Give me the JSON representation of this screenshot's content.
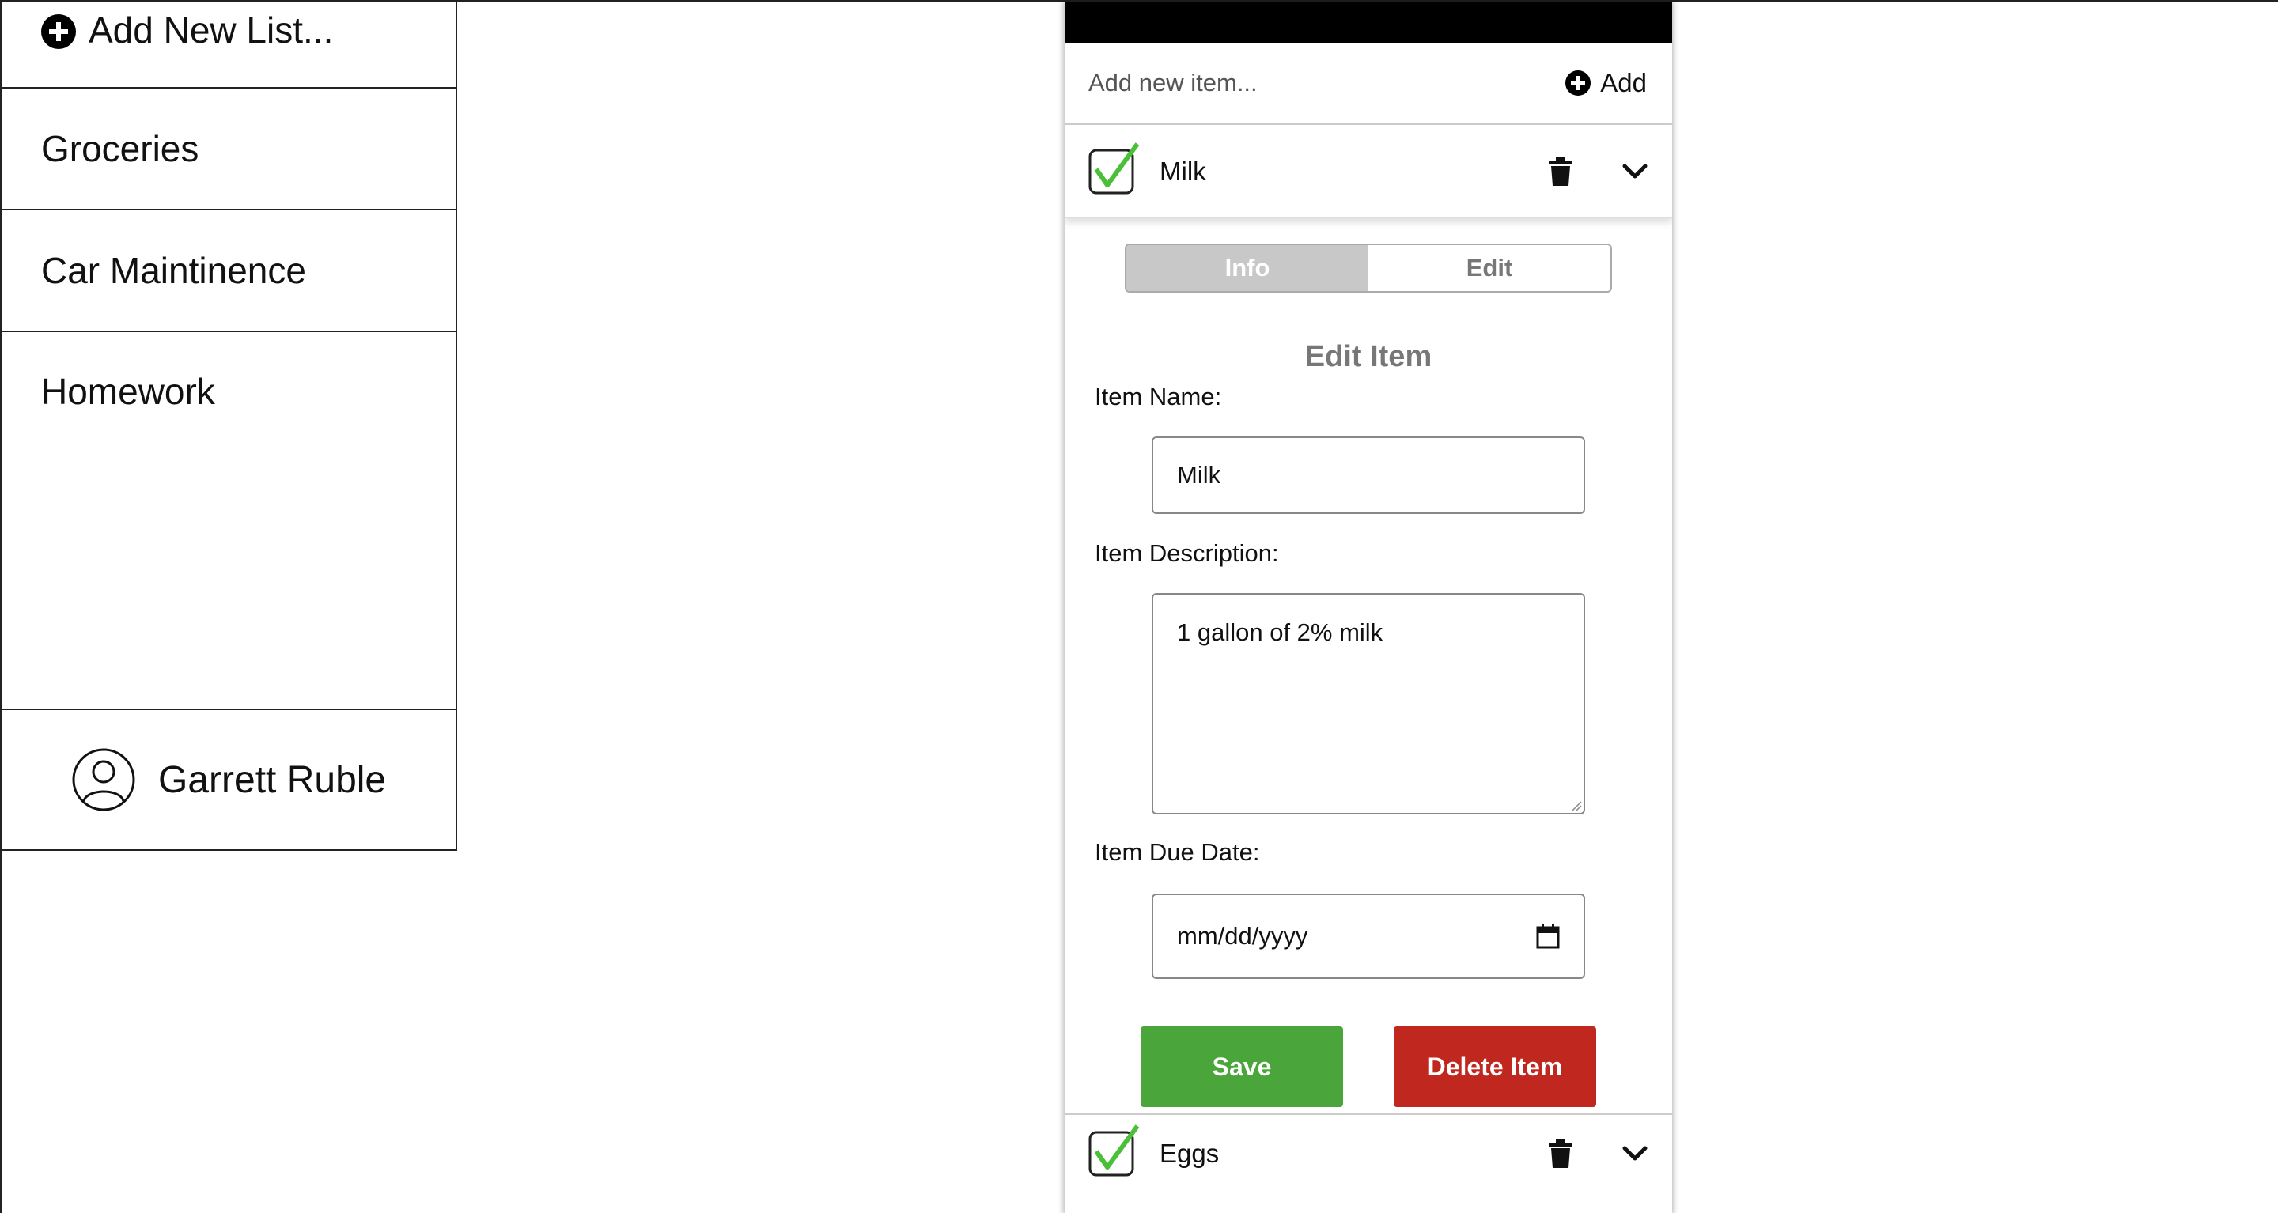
{
  "sidebar": {
    "add_list_label": "Add New List...",
    "lists": [
      {
        "label": "Groceries"
      },
      {
        "label": "Car Maintinence"
      },
      {
        "label": "Homework"
      }
    ],
    "user_name": "Garrett Ruble"
  },
  "panel": {
    "add_item_placeholder": "Add new item...",
    "add_button_label": "Add",
    "items": [
      {
        "name": "Milk",
        "checked": true,
        "expanded": true
      },
      {
        "name": "Eggs",
        "checked": true,
        "expanded": false
      }
    ],
    "tabs": [
      {
        "label": "Info",
        "active": true
      },
      {
        "label": "Edit",
        "active": false
      }
    ],
    "form": {
      "title": "Edit Item",
      "name_label": "Item Name:",
      "name_value": "Milk",
      "description_label": "Item Description:",
      "description_value": "1 gallon of 2% milk",
      "due_date_label": "Item Due Date:",
      "due_date_placeholder": "mm/dd/yyyy",
      "save_label": "Save",
      "delete_label": "Delete Item"
    }
  },
  "colors": {
    "save": "#4aa63a",
    "delete": "#c0271f",
    "check": "#4cbf3a",
    "active_tab": "#c8c8c8"
  }
}
